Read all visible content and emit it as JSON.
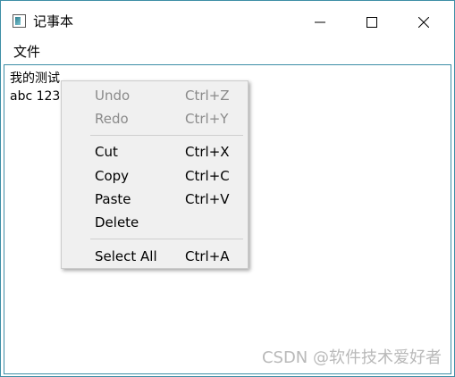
{
  "window": {
    "title": "记事本",
    "accent": "#3d8ea6"
  },
  "menubar": {
    "file": "文件"
  },
  "editor": {
    "lines": [
      "我的测试",
      "abc 123"
    ]
  },
  "context_menu": {
    "undo": {
      "label": "Undo",
      "shortcut": "Ctrl+Z",
      "enabled": false
    },
    "redo": {
      "label": "Redo",
      "shortcut": "Ctrl+Y",
      "enabled": false
    },
    "cut": {
      "label": "Cut",
      "shortcut": "Ctrl+X",
      "enabled": true
    },
    "copy": {
      "label": "Copy",
      "shortcut": "Ctrl+C",
      "enabled": true
    },
    "paste": {
      "label": "Paste",
      "shortcut": "Ctrl+V",
      "enabled": true
    },
    "delete": {
      "label": "Delete",
      "enabled": true
    },
    "select_all": {
      "label": "Select All",
      "shortcut": "Ctrl+A",
      "enabled": true
    }
  },
  "watermark": "CSDN @软件技术爱好者",
  "icons": {
    "app": "notepad-icon",
    "minimize": "minimize-icon",
    "maximize": "maximize-icon",
    "close": "close-icon"
  }
}
